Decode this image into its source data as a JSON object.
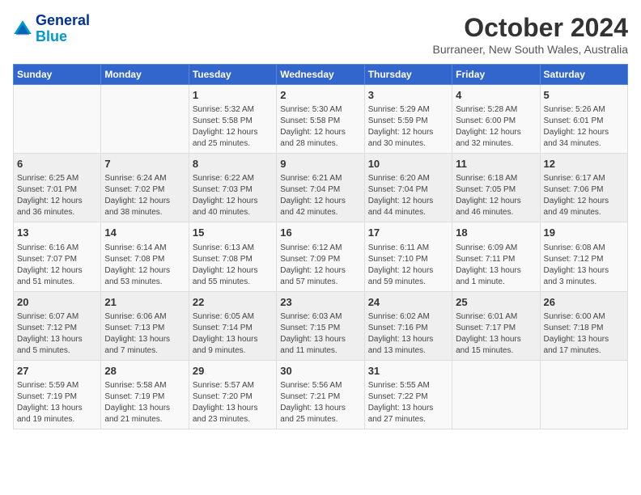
{
  "header": {
    "logo_line1": "General",
    "logo_line2": "Blue",
    "title": "October 2024",
    "subtitle": "Burraneer, New South Wales, Australia"
  },
  "days_of_week": [
    "Sunday",
    "Monday",
    "Tuesday",
    "Wednesday",
    "Thursday",
    "Friday",
    "Saturday"
  ],
  "weeks": [
    [
      {
        "num": "",
        "detail": ""
      },
      {
        "num": "",
        "detail": ""
      },
      {
        "num": "1",
        "detail": "Sunrise: 5:32 AM\nSunset: 5:58 PM\nDaylight: 12 hours\nand 25 minutes."
      },
      {
        "num": "2",
        "detail": "Sunrise: 5:30 AM\nSunset: 5:58 PM\nDaylight: 12 hours\nand 28 minutes."
      },
      {
        "num": "3",
        "detail": "Sunrise: 5:29 AM\nSunset: 5:59 PM\nDaylight: 12 hours\nand 30 minutes."
      },
      {
        "num": "4",
        "detail": "Sunrise: 5:28 AM\nSunset: 6:00 PM\nDaylight: 12 hours\nand 32 minutes."
      },
      {
        "num": "5",
        "detail": "Sunrise: 5:26 AM\nSunset: 6:01 PM\nDaylight: 12 hours\nand 34 minutes."
      }
    ],
    [
      {
        "num": "6",
        "detail": "Sunrise: 6:25 AM\nSunset: 7:01 PM\nDaylight: 12 hours\nand 36 minutes."
      },
      {
        "num": "7",
        "detail": "Sunrise: 6:24 AM\nSunset: 7:02 PM\nDaylight: 12 hours\nand 38 minutes."
      },
      {
        "num": "8",
        "detail": "Sunrise: 6:22 AM\nSunset: 7:03 PM\nDaylight: 12 hours\nand 40 minutes."
      },
      {
        "num": "9",
        "detail": "Sunrise: 6:21 AM\nSunset: 7:04 PM\nDaylight: 12 hours\nand 42 minutes."
      },
      {
        "num": "10",
        "detail": "Sunrise: 6:20 AM\nSunset: 7:04 PM\nDaylight: 12 hours\nand 44 minutes."
      },
      {
        "num": "11",
        "detail": "Sunrise: 6:18 AM\nSunset: 7:05 PM\nDaylight: 12 hours\nand 46 minutes."
      },
      {
        "num": "12",
        "detail": "Sunrise: 6:17 AM\nSunset: 7:06 PM\nDaylight: 12 hours\nand 49 minutes."
      }
    ],
    [
      {
        "num": "13",
        "detail": "Sunrise: 6:16 AM\nSunset: 7:07 PM\nDaylight: 12 hours\nand 51 minutes."
      },
      {
        "num": "14",
        "detail": "Sunrise: 6:14 AM\nSunset: 7:08 PM\nDaylight: 12 hours\nand 53 minutes."
      },
      {
        "num": "15",
        "detail": "Sunrise: 6:13 AM\nSunset: 7:08 PM\nDaylight: 12 hours\nand 55 minutes."
      },
      {
        "num": "16",
        "detail": "Sunrise: 6:12 AM\nSunset: 7:09 PM\nDaylight: 12 hours\nand 57 minutes."
      },
      {
        "num": "17",
        "detail": "Sunrise: 6:11 AM\nSunset: 7:10 PM\nDaylight: 12 hours\nand 59 minutes."
      },
      {
        "num": "18",
        "detail": "Sunrise: 6:09 AM\nSunset: 7:11 PM\nDaylight: 13 hours\nand 1 minute."
      },
      {
        "num": "19",
        "detail": "Sunrise: 6:08 AM\nSunset: 7:12 PM\nDaylight: 13 hours\nand 3 minutes."
      }
    ],
    [
      {
        "num": "20",
        "detail": "Sunrise: 6:07 AM\nSunset: 7:12 PM\nDaylight: 13 hours\nand 5 minutes."
      },
      {
        "num": "21",
        "detail": "Sunrise: 6:06 AM\nSunset: 7:13 PM\nDaylight: 13 hours\nand 7 minutes."
      },
      {
        "num": "22",
        "detail": "Sunrise: 6:05 AM\nSunset: 7:14 PM\nDaylight: 13 hours\nand 9 minutes."
      },
      {
        "num": "23",
        "detail": "Sunrise: 6:03 AM\nSunset: 7:15 PM\nDaylight: 13 hours\nand 11 minutes."
      },
      {
        "num": "24",
        "detail": "Sunrise: 6:02 AM\nSunset: 7:16 PM\nDaylight: 13 hours\nand 13 minutes."
      },
      {
        "num": "25",
        "detail": "Sunrise: 6:01 AM\nSunset: 7:17 PM\nDaylight: 13 hours\nand 15 minutes."
      },
      {
        "num": "26",
        "detail": "Sunrise: 6:00 AM\nSunset: 7:18 PM\nDaylight: 13 hours\nand 17 minutes."
      }
    ],
    [
      {
        "num": "27",
        "detail": "Sunrise: 5:59 AM\nSunset: 7:19 PM\nDaylight: 13 hours\nand 19 minutes."
      },
      {
        "num": "28",
        "detail": "Sunrise: 5:58 AM\nSunset: 7:19 PM\nDaylight: 13 hours\nand 21 minutes."
      },
      {
        "num": "29",
        "detail": "Sunrise: 5:57 AM\nSunset: 7:20 PM\nDaylight: 13 hours\nand 23 minutes."
      },
      {
        "num": "30",
        "detail": "Sunrise: 5:56 AM\nSunset: 7:21 PM\nDaylight: 13 hours\nand 25 minutes."
      },
      {
        "num": "31",
        "detail": "Sunrise: 5:55 AM\nSunset: 7:22 PM\nDaylight: 13 hours\nand 27 minutes."
      },
      {
        "num": "",
        "detail": ""
      },
      {
        "num": "",
        "detail": ""
      }
    ]
  ]
}
